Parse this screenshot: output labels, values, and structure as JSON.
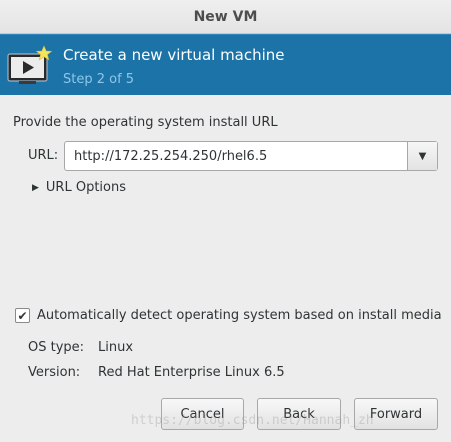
{
  "window": {
    "title": "New VM"
  },
  "header": {
    "title": "Create a new virtual machine",
    "step": "Step 2 of 5",
    "icon": "virtual-machine-new-icon",
    "background_color": "#1c73a8",
    "step_color": "#8fc6ea"
  },
  "form": {
    "prompt": "Provide the operating system install URL",
    "url_label": "URL:",
    "url_value": "http://172.25.254.250/rhel6.5",
    "url_options_label": "URL Options",
    "auto_detect_label": "Automatically detect operating system based on install media",
    "auto_detect_checked": true,
    "os_type_label": "OS type:",
    "os_type_value": "Linux",
    "version_label": "Version:",
    "version_value": "Red Hat Enterprise Linux 6.5"
  },
  "buttons": {
    "cancel": "Cancel",
    "back": "Back",
    "forward": "Forward"
  },
  "watermark": "https://blog.csdn.net/Hannah_zh"
}
